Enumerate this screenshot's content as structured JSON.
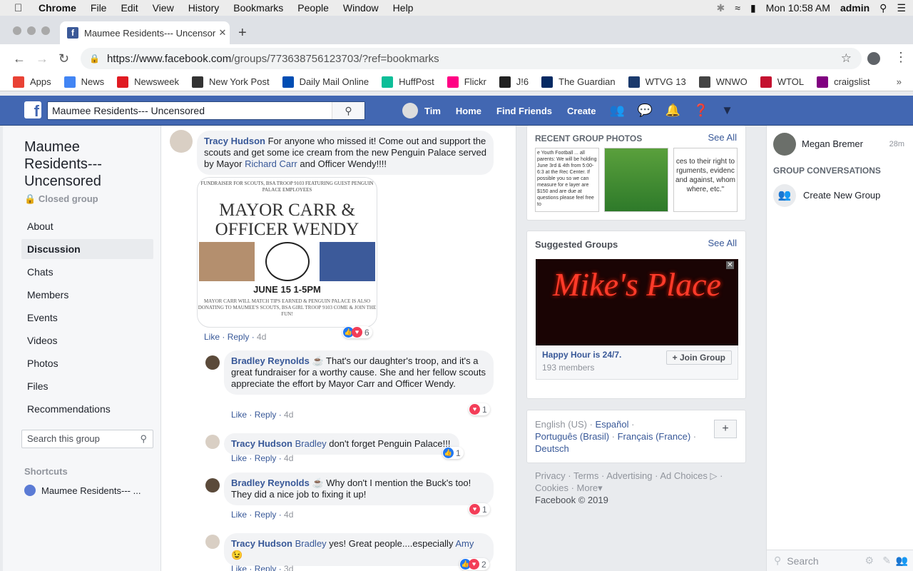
{
  "menubar": {
    "app": "Chrome",
    "items": [
      "File",
      "Edit",
      "View",
      "History",
      "Bookmarks",
      "People",
      "Window",
      "Help"
    ],
    "clock": "Mon 10:58 AM",
    "user": "admin"
  },
  "browser": {
    "tab_title": "Maumee Residents--- Uncensored",
    "url_host": "https://www.facebook.com",
    "url_path": "/groups/773638756123703/?ref=bookmarks"
  },
  "bookmarks": [
    {
      "label": "Apps",
      "color": "#e94235"
    },
    {
      "label": "News",
      "color": "#4285f4"
    },
    {
      "label": "Newsweek",
      "color": "#e01b22"
    },
    {
      "label": "New York Post",
      "color": "#333333"
    },
    {
      "label": "Daily Mail Online",
      "color": "#004db3"
    },
    {
      "label": "HuffPost",
      "color": "#0dbe98"
    },
    {
      "label": "Flickr",
      "color": "#ff0084"
    },
    {
      "label": "J!6",
      "color": "#222222"
    },
    {
      "label": "The Guardian",
      "color": "#052962"
    },
    {
      "label": "WTVG 13",
      "color": "#1b3a6d"
    },
    {
      "label": "WNWO",
      "color": "#444444"
    },
    {
      "label": "WTOL",
      "color": "#c41230"
    },
    {
      "label": "craigslist",
      "color": "#800080"
    }
  ],
  "fb": {
    "search_value": "Maumee Residents--- Uncensored",
    "user_name": "Tim",
    "nav": [
      "Home",
      "Find Friends",
      "Create"
    ]
  },
  "group": {
    "name": "Maumee Residents--- Uncensored",
    "privacy": "Closed group",
    "nav": [
      "About",
      "Discussion",
      "Chats",
      "Members",
      "Events",
      "Videos",
      "Photos",
      "Files",
      "Recommendations"
    ],
    "search_placeholder": "Search this group",
    "shortcuts_heading": "Shortcuts",
    "shortcut_label": "Maumee Residents--- ..."
  },
  "comments": [
    {
      "author": "Tracy Hudson",
      "text_before": "For anyone who missed it! Come out and support the scouts and get some ice cream from the new Penguin Palace served by Mayor ",
      "mention": "Richard Carr",
      "text_after": " and Officer Wendy!!!!",
      "like": "Like",
      "reply": "Reply",
      "age": "4d",
      "reactions": "6"
    },
    {
      "author": "Bradley Reynolds",
      "text": "☕ That's our daughter's troop, and it's a great fundraiser for a worthy cause. She and her fellow scouts appreciate the effort by Mayor Carr and Officer Wendy.",
      "like": "Like",
      "reply": "Reply",
      "age": "4d",
      "reactions": "1"
    },
    {
      "author": "Tracy Hudson",
      "mention": "Bradley",
      "text": "don't forget Penguin Palace!!!",
      "like": "Like",
      "reply": "Reply",
      "age": "4d",
      "reactions": "1"
    },
    {
      "author": "Bradley Reynolds",
      "text": "☕ Why don't I mention the Buck's too! They did a nice job to fixing it up!",
      "like": "Like",
      "reply": "Reply",
      "age": "4d",
      "reactions": "1"
    },
    {
      "author": "Tracy Hudson",
      "mention": "Bradley",
      "text_before": "yes! Great people....especially ",
      "mention2": "Amy",
      "emoji": "😉",
      "like": "Like",
      "reply": "Reply",
      "age": "3d",
      "reactions": "2"
    }
  ],
  "poster": {
    "top": "FUNDRAISER FOR SCOUTS, BSA TROOP 9103 FEATURING GUEST PENGUIN PALACE EMPLOYEES",
    "headline1": "MAYOR CARR &",
    "headline2": "OFFICER WENDY",
    "date": "JUNE 15  1-5PM",
    "note": "MAYOR CARR WILL MATCH TIPS EARNED & PENGUIN PALACE IS ALSO DONATING TO MAUMEE'S SCOUTS, BSA GIRL TROOP 9103 COME & JOIN THE FUN!"
  },
  "right": {
    "photos_heading": "RECENT GROUP PHOTOS",
    "see_all": "See All",
    "thumb1": "e Youth Football ... all parents: We will be holding June 3rd & 4th from 5:00-6:3 at the Rec Center. If possible you so we can measure for e layer are $150 and are due at questions please feel free to",
    "thumb3": "ces to their right to rguments, evidenc and against, whom where, etc.\"",
    "suggested_heading": "Suggested Groups",
    "suggested_see_all": "See All",
    "ad_text": "Mike's Place",
    "group_name": "Happy Hour is 24/7.",
    "group_members": "193 members",
    "join": "Join Group",
    "languages": [
      "English (US)",
      "Español",
      "Português (Brasil)",
      "Français (France)",
      "Deutsch"
    ],
    "footer_links": [
      "Privacy",
      "Terms",
      "Advertising",
      "Ad Choices",
      "Cookies",
      "More"
    ],
    "copyright": "Facebook © 2019"
  },
  "chat": {
    "contact": "Megan Bremer",
    "contact_time": "28m",
    "conversations_heading": "GROUP CONVERSATIONS",
    "create_group": "Create New Group",
    "search_placeholder": "Search"
  }
}
